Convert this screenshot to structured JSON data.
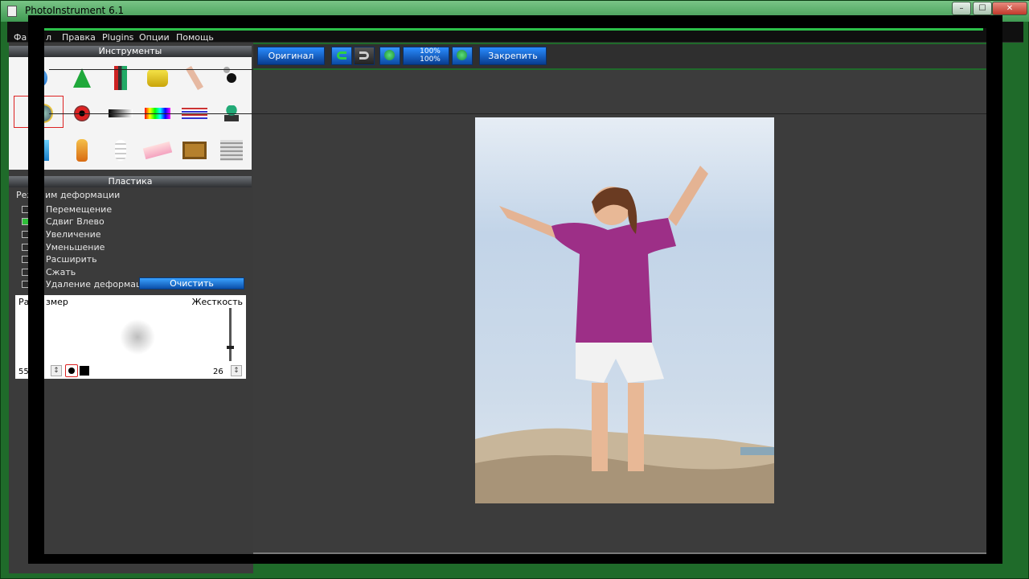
{
  "window": {
    "title": "PhotoInstrument 6.1"
  },
  "menu": {
    "items": [
      "Фа",
      "л",
      "Правка",
      "Plugins",
      "Опции",
      "Помощь"
    ]
  },
  "panels": {
    "tools_header": "Инструменты",
    "plastica_header": "Пластика"
  },
  "deform": {
    "mode_label_a": "Реж",
    "mode_label_b": "им деформации",
    "options": [
      {
        "label": "Перемещение",
        "checked": false
      },
      {
        "label": "Сдвиг Влево",
        "checked": true
      },
      {
        "label": "Увеличение",
        "checked": false
      },
      {
        "label": "Уменьшение",
        "checked": false
      },
      {
        "label": "Расширить",
        "checked": false
      },
      {
        "label": "Сжать",
        "checked": false
      },
      {
        "label": "Удаление деформации",
        "checked": false
      }
    ],
    "clear_label": "Очистить"
  },
  "brush": {
    "size_label_a": "Ра",
    "size_label_b": "змер",
    "hardness_label": "Жесткость",
    "size_value": "55",
    "hardness_value": "26",
    "hardness_level": 0.26
  },
  "toolbar": {
    "original_label": "Оригинал",
    "zoom_top": "100%",
    "zoom_bottom": "100%",
    "pin_label": "Закрепить"
  },
  "colors": {
    "title_green": "#3f9a52",
    "accent_blue": "#0b4ea8",
    "panel_dark": "#3b3b3b",
    "selection_red": "#dd2222"
  }
}
